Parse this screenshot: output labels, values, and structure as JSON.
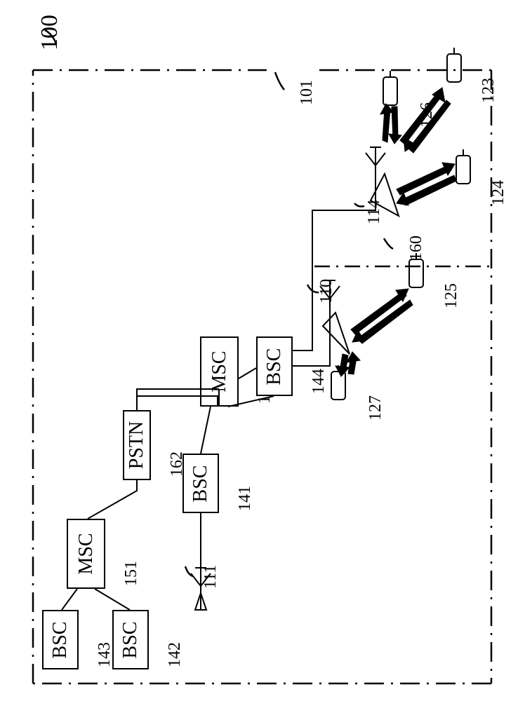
{
  "diagram": {
    "ref_top": "100",
    "blocks": {
      "pstn": {
        "label": "PSTN",
        "ref": "162"
      },
      "msc_left": {
        "label": "MSC",
        "ref": "151"
      },
      "msc_right": {
        "label": "MSC",
        "ref": "152"
      },
      "bsc_a": {
        "label": "BSC",
        "ref": "143"
      },
      "bsc_b": {
        "label": "BSC",
        "ref": "142"
      },
      "bsc_c": {
        "label": "BSC",
        "ref": "141"
      },
      "bsc_d": {
        "label": "BSC",
        "ref": "144"
      }
    },
    "antennas": {
      "a111": "111",
      "a110": "110",
      "a114": "114"
    },
    "devices": {
      "d126": "126",
      "d123": "123",
      "d124": "124",
      "d125": "125",
      "d127": "127"
    },
    "misc": {
      "boundary": "101",
      "region160": "160"
    }
  }
}
